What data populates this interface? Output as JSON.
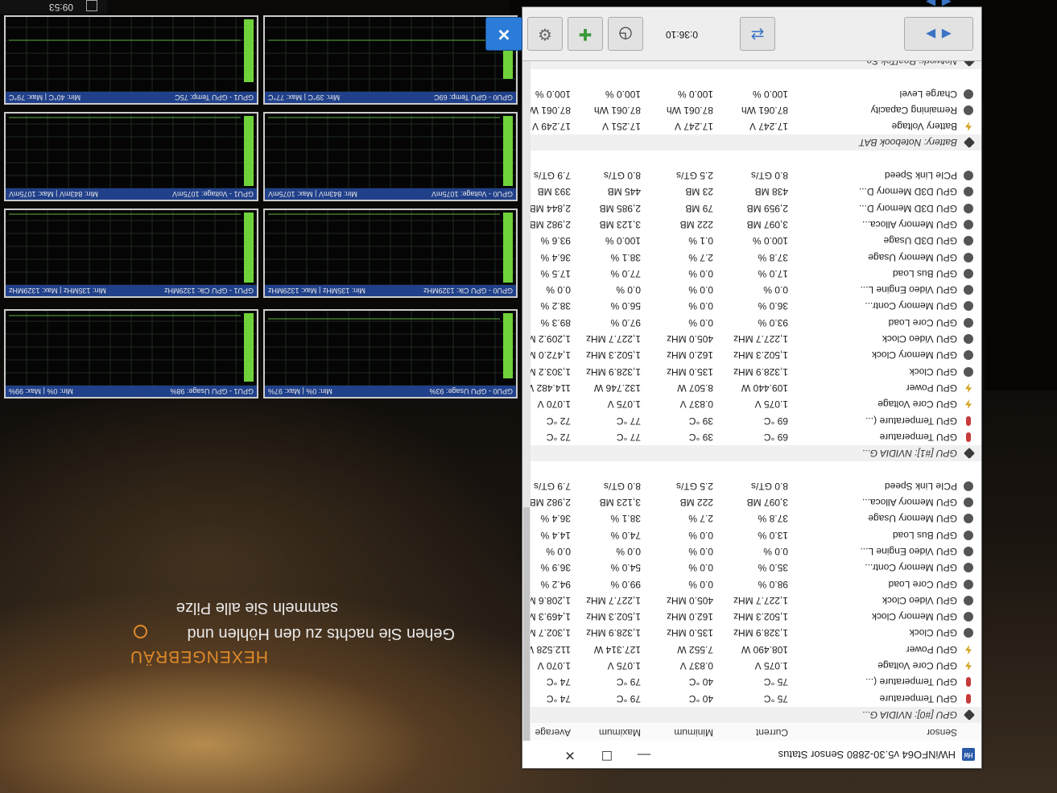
{
  "window": {
    "title": "HWiNFO64 v5.30-2880 Sensor Status",
    "minimize": "—",
    "maximize": "☐",
    "close": "✕"
  },
  "columns": {
    "sensor": "Sensor",
    "current": "Current",
    "minimum": "Minimum",
    "maximum": "Maximum",
    "average": "Average"
  },
  "rows": [
    {
      "type": "group",
      "name": "GPU [#0]: NVIDIA G..."
    },
    {
      "type": "sensor",
      "icon": "thermometer",
      "name": "GPU Temperature",
      "current": "75 °C",
      "minimum": "40 °C",
      "maximum": "79 °C",
      "average": "74 °C"
    },
    {
      "type": "sensor",
      "icon": "thermometer",
      "name": "GPU Temperature (...",
      "current": "75 °C",
      "minimum": "40 °C",
      "maximum": "79 °C",
      "average": "74 °C"
    },
    {
      "type": "sensor",
      "icon": "voltage",
      "name": "GPU Core Voltage",
      "current": "1.075 V",
      "minimum": "0.837 V",
      "maximum": "1.075 V",
      "average": "1.070 V"
    },
    {
      "type": "sensor",
      "icon": "voltage",
      "name": "GPU Power",
      "current": "108.490 W",
      "minimum": "7.552 W",
      "maximum": "127.314 W",
      "average": "112.528 W"
    },
    {
      "type": "sensor",
      "icon": "clock",
      "name": "GPU Clock",
      "current": "1,328.9 MHz",
      "minimum": "135.0 MHz",
      "maximum": "1,328.9 MHz",
      "average": "1,302.7 MHz"
    },
    {
      "type": "sensor",
      "icon": "clock",
      "name": "GPU Memory Clock",
      "current": "1,502.3 MHz",
      "minimum": "162.0 MHz",
      "maximum": "1,502.3 MHz",
      "average": "1,469.3 MHz"
    },
    {
      "type": "sensor",
      "icon": "clock",
      "name": "GPU Video Clock",
      "current": "1,227.7 MHz",
      "minimum": "405.0 MHz",
      "maximum": "1,227.7 MHz",
      "average": "1,208.6 MHz"
    },
    {
      "type": "sensor",
      "icon": "gauge",
      "name": "GPU Core Load",
      "current": "98.0 %",
      "minimum": "0.0 %",
      "maximum": "99.0 %",
      "average": "94.2 %"
    },
    {
      "type": "sensor",
      "icon": "gauge",
      "name": "GPU Memory Contr...",
      "current": "35.0 %",
      "minimum": "0.0 %",
      "maximum": "54.0 %",
      "average": "36.9 %"
    },
    {
      "type": "sensor",
      "icon": "gauge",
      "name": "GPU Video Engine L...",
      "current": "0.0 %",
      "minimum": "0.0 %",
      "maximum": "0.0 %",
      "average": "0.0 %"
    },
    {
      "type": "sensor",
      "icon": "gauge",
      "name": "GPU Bus Load",
      "current": "13.0 %",
      "minimum": "0.0 %",
      "maximum": "74.0 %",
      "average": "14.4 %"
    },
    {
      "type": "sensor",
      "icon": "gauge",
      "name": "GPU Memory Usage",
      "current": "37.8 %",
      "minimum": "2.7 %",
      "maximum": "38.1 %",
      "average": "36.4 %"
    },
    {
      "type": "sensor",
      "icon": "gauge",
      "name": "GPU Memory Alloca...",
      "current": "3,097 MB",
      "minimum": "222 MB",
      "maximum": "3,123 MB",
      "average": "2,982 MB"
    },
    {
      "type": "sensor",
      "icon": "gauge",
      "name": "PCIe Link Speed",
      "current": "8.0 GT/s",
      "minimum": "2.5 GT/s",
      "maximum": "8.0 GT/s",
      "average": "7.9 GT/s"
    },
    {
      "type": "spacer"
    },
    {
      "type": "group",
      "name": "GPU [#1]: NVIDIA G..."
    },
    {
      "type": "sensor",
      "icon": "thermometer",
      "name": "GPU Temperature",
      "current": "69 °C",
      "minimum": "39 °C",
      "maximum": "77 °C",
      "average": "72 °C"
    },
    {
      "type": "sensor",
      "icon": "thermometer",
      "name": "GPU Temperature (...",
      "current": "69 °C",
      "minimum": "39 °C",
      "maximum": "77 °C",
      "average": "72 °C"
    },
    {
      "type": "sensor",
      "icon": "voltage",
      "name": "GPU Core Voltage",
      "current": "1.075 V",
      "minimum": "0.837 V",
      "maximum": "1.075 V",
      "average": "1.070 V"
    },
    {
      "type": "sensor",
      "icon": "voltage",
      "name": "GPU Power",
      "current": "109.440 W",
      "minimum": "8.507 W",
      "maximum": "132.746 W",
      "average": "114.482 W"
    },
    {
      "type": "sensor",
      "icon": "clock",
      "name": "GPU Clock",
      "current": "1,328.9 MHz",
      "minimum": "135.0 MHz",
      "maximum": "1,328.9 MHz",
      "average": "1,303.2 MHz"
    },
    {
      "type": "sensor",
      "icon": "clock",
      "name": "GPU Memory Clock",
      "current": "1,502.3 MHz",
      "minimum": "162.0 MHz",
      "maximum": "1,502.3 MHz",
      "average": "1,472.0 MHz"
    },
    {
      "type": "sensor",
      "icon": "clock",
      "name": "GPU Video Clock",
      "current": "1,227.7 MHz",
      "minimum": "405.0 MHz",
      "maximum": "1,227.7 MHz",
      "average": "1,209.2 MHz"
    },
    {
      "type": "sensor",
      "icon": "gauge",
      "name": "GPU Core Load",
      "current": "93.0 %",
      "minimum": "0.0 %",
      "maximum": "97.0 %",
      "average": "89.3 %"
    },
    {
      "type": "sensor",
      "icon": "gauge",
      "name": "GPU Memory Contr...",
      "current": "36.0 %",
      "minimum": "0.0 %",
      "maximum": "56.0 %",
      "average": "38.2 %"
    },
    {
      "type": "sensor",
      "icon": "gauge",
      "name": "GPU Video Engine L...",
      "current": "0.0 %",
      "minimum": "0.0 %",
      "maximum": "0.0 %",
      "average": "0.0 %"
    },
    {
      "type": "sensor",
      "icon": "gauge",
      "name": "GPU Bus Load",
      "current": "17.0 %",
      "minimum": "0.0 %",
      "maximum": "77.0 %",
      "average": "17.5 %"
    },
    {
      "type": "sensor",
      "icon": "gauge",
      "name": "GPU Memory Usage",
      "current": "37.8 %",
      "minimum": "2.7 %",
      "maximum": "38.1 %",
      "average": "36.4 %"
    },
    {
      "type": "sensor",
      "icon": "gauge",
      "name": "GPU D3D Usage",
      "current": "100.0 %",
      "minimum": "0.1 %",
      "maximum": "100.0 %",
      "average": "93.6 %"
    },
    {
      "type": "sensor",
      "icon": "gauge",
      "name": "GPU Memory Alloca...",
      "current": "3,097 MB",
      "minimum": "222 MB",
      "maximum": "3,123 MB",
      "average": "2,982 MB"
    },
    {
      "type": "sensor",
      "icon": "gauge",
      "name": "GPU D3D Memory D...",
      "current": "2,959 MB",
      "minimum": "79 MB",
      "maximum": "2,985 MB",
      "average": "2,844 MB"
    },
    {
      "type": "sensor",
      "icon": "gauge",
      "name": "GPU D3D Memory D...",
      "current": "438 MB",
      "minimum": "23 MB",
      "maximum": "445 MB",
      "average": "393 MB"
    },
    {
      "type": "sensor",
      "icon": "gauge",
      "name": "PCIe Link Speed",
      "current": "8.0 GT/s",
      "minimum": "2.5 GT/s",
      "maximum": "8.0 GT/s",
      "average": "7.9 GT/s"
    },
    {
      "type": "spacer"
    },
    {
      "type": "group",
      "name": "Battery: Notebook BAT"
    },
    {
      "type": "sensor",
      "icon": "voltage",
      "name": "Battery Voltage",
      "current": "17.247 V",
      "minimum": "17.247 V",
      "maximum": "17.251 V",
      "average": "17.249 V"
    },
    {
      "type": "sensor",
      "icon": "gauge",
      "name": "Remaining Capacity",
      "current": "87.061 Wh",
      "minimum": "87.061 Wh",
      "maximum": "87.061 Wh",
      "average": "87.061 Wh"
    },
    {
      "type": "sensor",
      "icon": "gauge",
      "name": "Charge Level",
      "current": "100.0 %",
      "minimum": "100.0 %",
      "maximum": "100.0 %",
      "average": "100.0 %"
    },
    {
      "type": "spacer"
    },
    {
      "type": "group",
      "name": "Network: RealTek Se..."
    }
  ],
  "toolbar": {
    "nav": "◄► ◄►",
    "network": "⇄",
    "elapsed": "0:36:10",
    "clock": "◷",
    "add": "✚",
    "settings": "⚙",
    "close": "✕"
  },
  "graphs": [
    {
      "title": "GPU0 - GPU Usage: 93%",
      "range": "Min: 0% | Max: 97%",
      "level": 0.93,
      "line": 0.08
    },
    {
      "title": "GPU1 - GPU Usage: 98%",
      "range": "Min: 0% | Max: 99%",
      "level": 0.98,
      "line": 0.04
    },
    {
      "title": "GPU0 - GPU Clk: 1329MHz",
      "range": "Min: 135MHz | Max: 1329MHz",
      "level": 1.0,
      "line": 0.02
    },
    {
      "title": "GPU1 - GPU Clk: 1329MHz",
      "range": "Min: 135MHz | Max: 1329MHz",
      "level": 1.0,
      "line": 0.02
    },
    {
      "title": "GPU0 - Voltage: 1075mV",
      "range": "Min: 843mV | Max: 1075mV",
      "level": 1.0,
      "line": 0.02
    },
    {
      "title": "GPU1 - Voltage: 1075mV",
      "range": "Min: 843mV | Max: 1075mV",
      "level": 1.0,
      "line": 0.02
    },
    {
      "title": "GPU0 - GPU Temp: 69C",
      "range": "Min: 39°C | Max: 77°C",
      "level": 0.85,
      "line": 0.3
    },
    {
      "title": "GPU1 - GPU Temp: 75C",
      "range": "Min: 40°C | Max: 79°C",
      "level": 0.9,
      "line": 0.3
    }
  ],
  "game": {
    "brand": "HEXENGEBRÄU",
    "line1": "Gehen Sie nachts zu den Höhlen und",
    "line2": "sammeln Sie alle Pilze",
    "clock": "09:53"
  }
}
